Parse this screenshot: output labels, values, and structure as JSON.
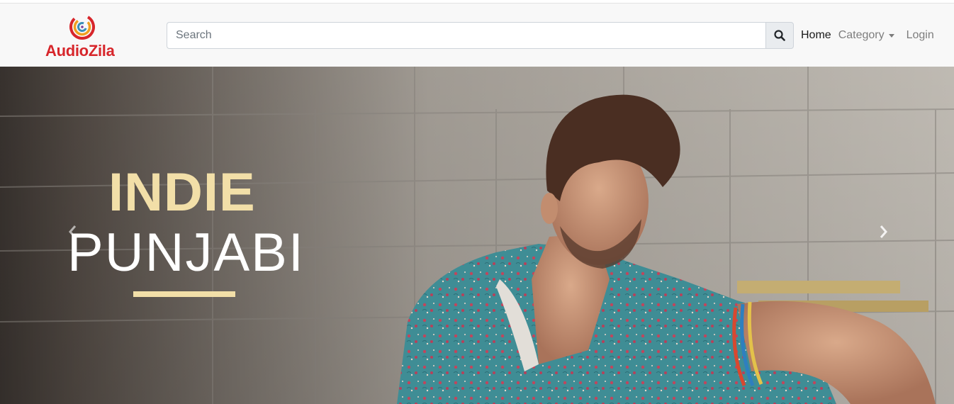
{
  "brand": {
    "name": "AudioZila",
    "color": "#d7262b"
  },
  "search": {
    "placeholder": "Search",
    "value": "",
    "button_icon": "search-icon"
  },
  "nav": {
    "home": "Home",
    "category": "Category",
    "login": "Login"
  },
  "carousel": {
    "slide": {
      "title_line_1": "INDIE",
      "title_line_2": "PUNJABI",
      "accent_color": "#f2dfa8"
    },
    "prev_icon": "chevron-left-icon",
    "next_icon": "chevron-right-icon"
  }
}
